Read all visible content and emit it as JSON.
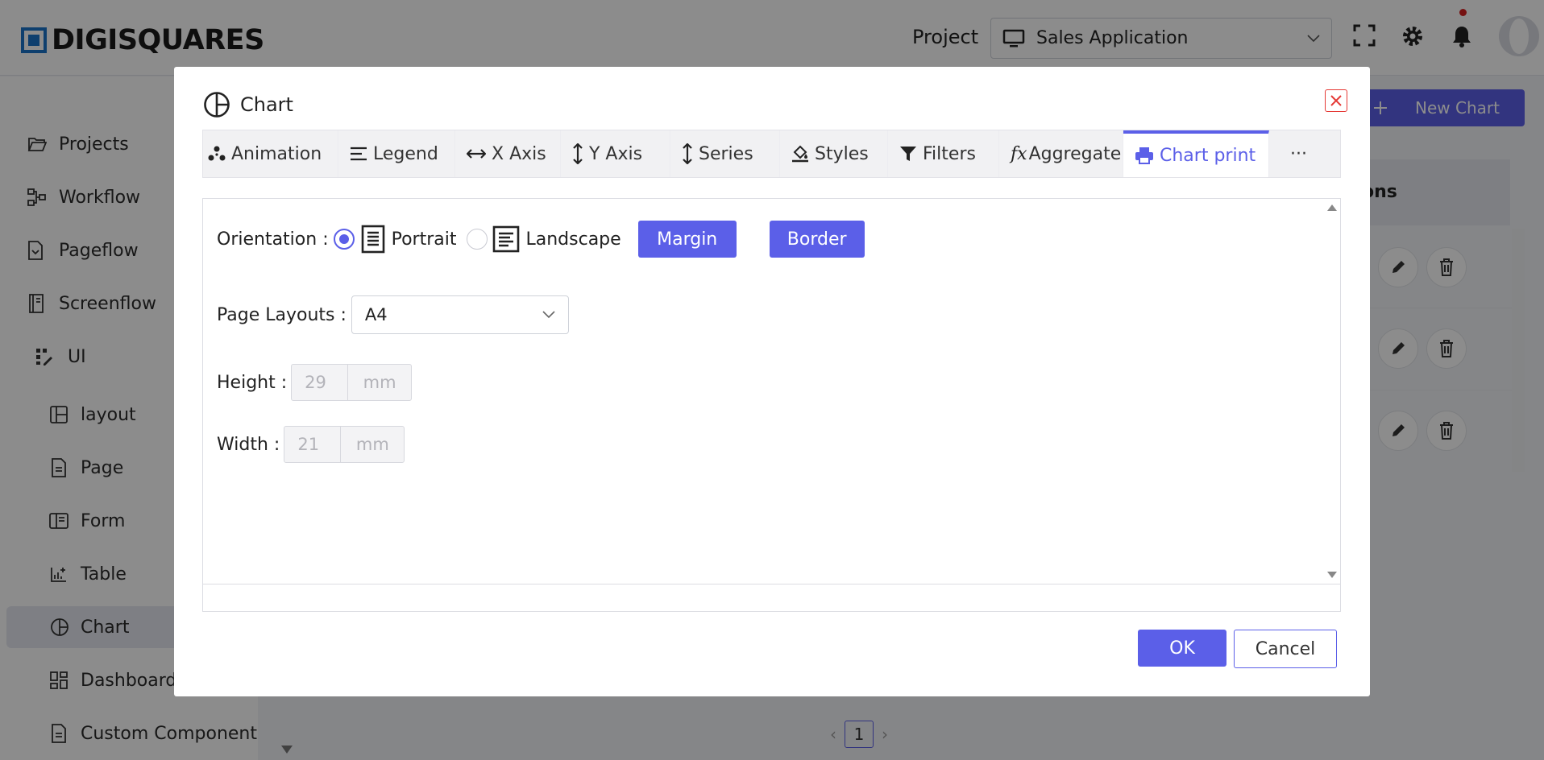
{
  "app": {
    "logo_text": "DIGISQUARES",
    "project_label": "Project",
    "project_selected": "Sales Application"
  },
  "sidebar": {
    "items": [
      {
        "label": "Projects",
        "icon": "folder-open-icon"
      },
      {
        "label": "Workflow",
        "icon": "workflow-icon"
      },
      {
        "label": "Pageflow",
        "icon": "pageflow-icon"
      },
      {
        "label": "Screenflow",
        "icon": "screenflow-icon"
      },
      {
        "label": "UI",
        "icon": "ui-icon"
      },
      {
        "label": "layout",
        "icon": "layout-icon"
      },
      {
        "label": "Page",
        "icon": "page-icon"
      },
      {
        "label": "Form",
        "icon": "form-icon"
      },
      {
        "label": "Table",
        "icon": "table-chart-icon"
      },
      {
        "label": "Chart",
        "icon": "pie-chart-icon"
      },
      {
        "label": "Dashboard",
        "icon": "dashboard-icon"
      },
      {
        "label": "Custom Component",
        "icon": "custom-component-icon"
      }
    ],
    "active": "Chart"
  },
  "main": {
    "new_button": "New Chart",
    "column_header_partial": "ons",
    "page_number": "1"
  },
  "dialog": {
    "title": "Chart",
    "tabs": [
      {
        "label": "Animation",
        "icon": "animation-icon"
      },
      {
        "label": "Legend",
        "icon": "legend-icon"
      },
      {
        "label": "X Axis",
        "icon": "horizontal-arrows-icon"
      },
      {
        "label": "Y Axis",
        "icon": "vertical-arrows-icon"
      },
      {
        "label": "Series",
        "icon": "vertical-arrows-icon"
      },
      {
        "label": "Styles",
        "icon": "paint-bucket-icon"
      },
      {
        "label": "Filters",
        "icon": "filter-icon"
      },
      {
        "label": "Aggregate",
        "icon": "function-icon"
      },
      {
        "label": "Chart print",
        "icon": "printer-icon"
      },
      {
        "label": "···",
        "icon": "more-icon"
      }
    ],
    "active_tab": "Chart print",
    "orientation": {
      "label": "Orientation :",
      "options": [
        "Portrait",
        "Landscape"
      ],
      "selected": "Portrait",
      "margin_button": "Margin",
      "border_button": "Border"
    },
    "page_layout": {
      "label": "Page Layouts :",
      "value": "A4"
    },
    "height": {
      "label": "Height :",
      "value": "29",
      "unit": "mm"
    },
    "width": {
      "label": "Width :",
      "value": "21",
      "unit": "mm"
    },
    "ok_button": "OK",
    "cancel_button": "Cancel"
  }
}
